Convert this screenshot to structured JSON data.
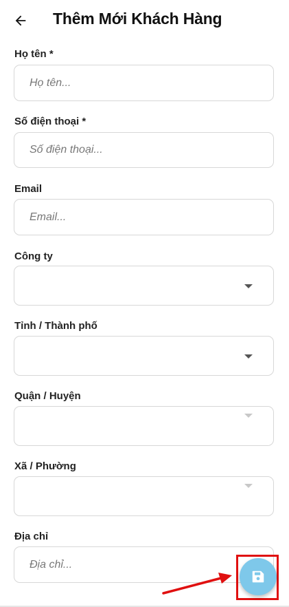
{
  "header": {
    "title": "Thêm Mới Khách Hàng"
  },
  "form": {
    "full_name": {
      "label": "Họ tên *",
      "placeholder": "Họ tên...",
      "value": ""
    },
    "phone": {
      "label": "Số điện thoại *",
      "placeholder": "Số điện thoại...",
      "value": ""
    },
    "email": {
      "label": "Email",
      "placeholder": "Email...",
      "value": ""
    },
    "company": {
      "label": "Công ty",
      "selected": ""
    },
    "province": {
      "label": "Tỉnh / Thành phố",
      "selected": ""
    },
    "district": {
      "label": "Quận / Huyện",
      "selected": "",
      "disabled": true
    },
    "ward": {
      "label": "Xã / Phường",
      "selected": "",
      "disabled": true
    },
    "address": {
      "label": "Địa chỉ",
      "placeholder": "Địa chỉ...",
      "value": ""
    }
  },
  "fab": {
    "icon": "floppy-disk-save-icon"
  },
  "colors": {
    "fab_background": "#7ec8ea",
    "highlight_border": "#e01010",
    "input_border": "#d7d7d7"
  }
}
